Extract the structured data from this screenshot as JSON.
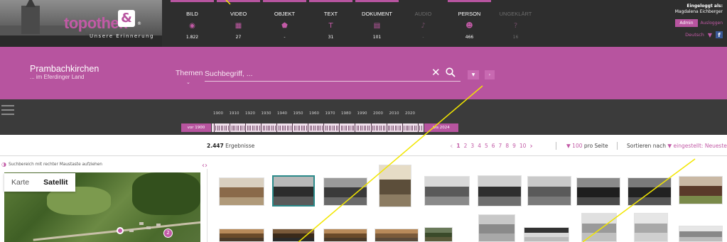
{
  "brand": {
    "name_prefix": "topo",
    "name_suffix": "thek",
    "mark": "&",
    "registered": "®",
    "tagline": "Unsere Erinnerung"
  },
  "categories": [
    {
      "label": "BILD",
      "icon": "camera-icon",
      "glyph": "◉",
      "count": "1.822",
      "enabled": true
    },
    {
      "label": "VIDEO",
      "icon": "video-icon",
      "glyph": "▦",
      "count": "27",
      "enabled": true
    },
    {
      "label": "OBJEKT",
      "icon": "object-icon",
      "glyph": "⬟",
      "count": "-",
      "enabled": true
    },
    {
      "label": "TEXT",
      "icon": "text-icon",
      "glyph": "T",
      "count": "31",
      "enabled": true
    },
    {
      "label": "DOKUMENT",
      "icon": "document-icon",
      "glyph": "▤",
      "count": "101",
      "enabled": true
    },
    {
      "label": "AUDIO",
      "icon": "audio-icon",
      "glyph": "♪",
      "count": "-",
      "enabled": false
    },
    {
      "label": "PERSON",
      "icon": "person-icon",
      "glyph": "☻",
      "count": "466",
      "enabled": true
    },
    {
      "label": "UNGEKLÄRT",
      "icon": "question-icon",
      "glyph": "?",
      "count": "16",
      "enabled": false
    }
  ],
  "user": {
    "logged_in_label": "Eingeloggt als:",
    "name": "Magdalena Eichberger",
    "admin_label": "Admin",
    "logout_label": "Ausloggen",
    "language": "Deutsch",
    "facebook": "f"
  },
  "band": {
    "place_name": "Prambachkirchen",
    "place_sub": "... im Eferdinger Land",
    "themen_label": "Themen",
    "search_placeholder": "Suchbegriff, ..."
  },
  "timeline": {
    "years": [
      "1900",
      "1910",
      "1920",
      "1930",
      "1940",
      "1950",
      "1960",
      "1970",
      "1980",
      "1990",
      "2000",
      "2010",
      "2020"
    ],
    "start_label": "vor 1900",
    "end_label": "bis 2024"
  },
  "results": {
    "count": "2.447",
    "count_label": "Ergebnisse",
    "pages": [
      "1",
      "2",
      "3",
      "4",
      "5",
      "6",
      "7",
      "8",
      "9",
      "10"
    ],
    "current_page": "1",
    "per_page_value": "100",
    "per_page_label": "pro Seite",
    "sort_label": "Sortieren nach",
    "sort_value": "eingestellt: Neueste"
  },
  "map": {
    "hint": "Suchbereich mit rechter Maustaste aufziehen",
    "type_map": "Karte",
    "type_satellite": "Satellit",
    "cluster_count": "2"
  },
  "colors": {
    "accent": "#b7549f",
    "accent_text": "#c25aa6",
    "dark_bar": "#2e2e2e",
    "timeline_bar": "#3b3b3b",
    "annotation": "#f2e600"
  }
}
